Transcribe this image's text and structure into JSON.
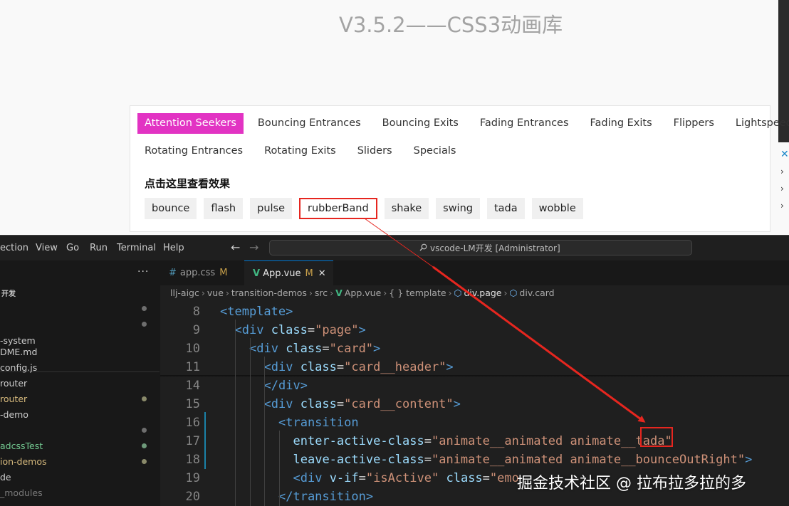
{
  "browser": {
    "page_title": "V3.5.2——CSS3动画库",
    "categories_row1": [
      "Attention Seekers",
      "Bouncing Entrances",
      "Bouncing Exits",
      "Fading Entrances",
      "Fading Exits",
      "Flippers",
      "Lightspeed"
    ],
    "categories_row2": [
      "Rotating Entrances",
      "Rotating Exits",
      "Sliders",
      "Specials"
    ],
    "active_category": "Attention Seekers",
    "effects_heading": "点击这里查看效果",
    "effects": [
      "bounce",
      "flash",
      "pulse",
      "rubberBand",
      "shake",
      "swing",
      "tada",
      "wobble"
    ],
    "highlighted_effect": "rubberBand",
    "accent_color": "#e233c3",
    "highlight_color": "#e6261f"
  },
  "vscode": {
    "menu": [
      "ection",
      "View",
      "Go",
      "Run",
      "Terminal",
      "Help"
    ],
    "nav_back": "←",
    "nav_forward": "→",
    "command_center": "vscode-LM开发 [Administrator]",
    "sidebar": {
      "more": "···",
      "root": "开发",
      "items": [
        "-system",
        "DME.md",
        "config.js",
        "router",
        "router",
        "-demo",
        "adcssTest",
        "ion-demos",
        "de",
        "_modules"
      ]
    },
    "tabs": [
      {
        "label": "app.css",
        "modified": "M"
      },
      {
        "label": "App.vue",
        "modified": "M",
        "close": "✕"
      }
    ],
    "breadcrumbs": [
      "llj-aigc",
      "vue",
      "transition-demos",
      "src",
      "App.vue",
      "{ } template",
      "div.page",
      "div.card"
    ],
    "lines": [
      {
        "n": "8",
        "parts": [
          [
            "tag",
            "<template>"
          ]
        ]
      },
      {
        "n": "9",
        "parts": [
          [
            "tag",
            "<div "
          ],
          [
            "attr",
            "class"
          ],
          [
            "eq",
            "="
          ],
          [
            "str",
            "\"page\""
          ],
          [
            "tag",
            ">"
          ]
        ]
      },
      {
        "n": "10",
        "parts": [
          [
            "tag",
            "<div "
          ],
          [
            "attr",
            "class"
          ],
          [
            "eq",
            "="
          ],
          [
            "str",
            "\"card\""
          ],
          [
            "tag",
            ">"
          ]
        ]
      },
      {
        "n": "11",
        "parts": [
          [
            "tag",
            "<div "
          ],
          [
            "attr",
            "class"
          ],
          [
            "eq",
            "="
          ],
          [
            "str",
            "\"card__header\""
          ],
          [
            "tag",
            ">"
          ]
        ]
      },
      {
        "n": "14",
        "parts": [
          [
            "tag",
            "</div>"
          ]
        ]
      },
      {
        "n": "15",
        "parts": [
          [
            "tag",
            "<div "
          ],
          [
            "attr",
            "class"
          ],
          [
            "eq",
            "="
          ],
          [
            "str",
            "\"card__content\""
          ],
          [
            "tag",
            ">"
          ]
        ]
      },
      {
        "n": "16",
        "parts": [
          [
            "tag",
            "<transition"
          ]
        ]
      },
      {
        "n": "17",
        "parts": [
          [
            "attr",
            "enter-active-class"
          ],
          [
            "eq",
            "="
          ],
          [
            "str",
            "\"animate__animated animate__tada\""
          ]
        ]
      },
      {
        "n": "18",
        "parts": [
          [
            "attr",
            "leave-active-class"
          ],
          [
            "eq",
            "="
          ],
          [
            "str",
            "\"animate__animated animate__bounceOutRight\""
          ],
          [
            "tag",
            ">"
          ]
        ]
      },
      {
        "n": "19",
        "parts": [
          [
            "tag",
            "<div "
          ],
          [
            "attr",
            "v-if"
          ],
          [
            "eq",
            "="
          ],
          [
            "str",
            "\"isActive\""
          ],
          [
            "attr",
            " class"
          ],
          [
            "eq",
            "="
          ],
          [
            "str",
            "\"emo"
          ]
        ]
      },
      {
        "n": "20",
        "parts": [
          [
            "tag",
            "</transition>"
          ]
        ]
      }
    ]
  },
  "watermark": "掘金技术社区 @ 拉布拉多拉的多"
}
